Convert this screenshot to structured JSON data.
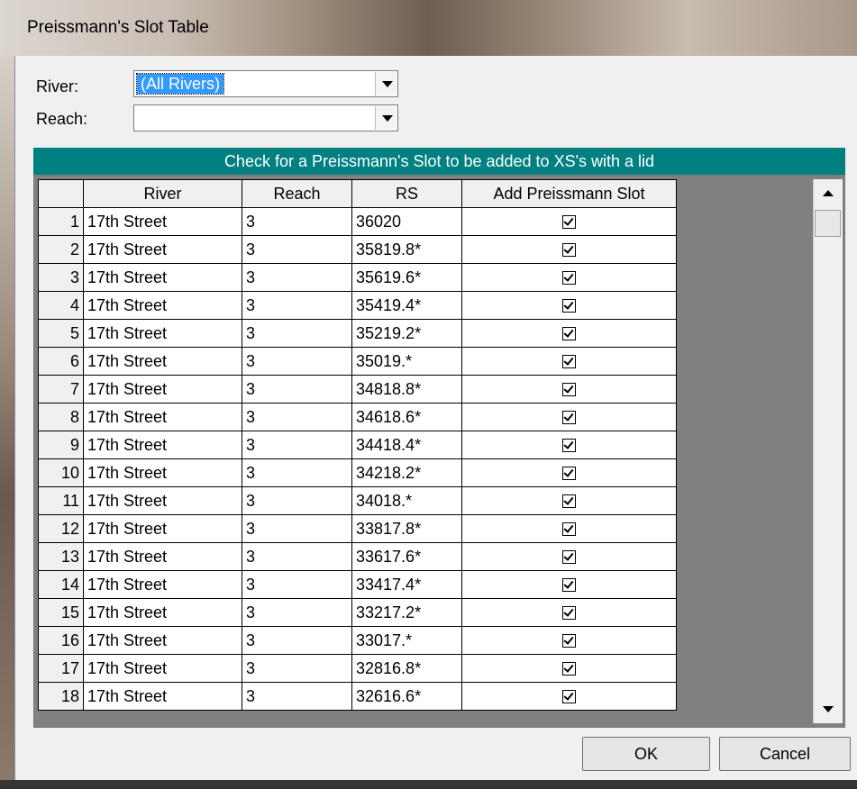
{
  "window": {
    "title": "Preissmann's Slot Table"
  },
  "river": {
    "label": "River:",
    "value": "(All Rivers)"
  },
  "reach": {
    "label": "Reach:",
    "value": ""
  },
  "banner": "Check for a Preissmann's Slot to be added to XS's with a lid",
  "table": {
    "headers": [
      "",
      "River",
      "Reach",
      "RS",
      "Add Preissmann Slot"
    ],
    "rows": [
      {
        "n": "1",
        "river": "17th Street",
        "reach": "3",
        "rs": "36020",
        "checked": true
      },
      {
        "n": "2",
        "river": "17th Street",
        "reach": "3",
        "rs": "35819.8*",
        "checked": true
      },
      {
        "n": "3",
        "river": "17th Street",
        "reach": "3",
        "rs": "35619.6*",
        "checked": true
      },
      {
        "n": "4",
        "river": "17th Street",
        "reach": "3",
        "rs": "35419.4*",
        "checked": true
      },
      {
        "n": "5",
        "river": "17th Street",
        "reach": "3",
        "rs": "35219.2*",
        "checked": true
      },
      {
        "n": "6",
        "river": "17th Street",
        "reach": "3",
        "rs": "35019.*",
        "checked": true
      },
      {
        "n": "7",
        "river": "17th Street",
        "reach": "3",
        "rs": "34818.8*",
        "checked": true
      },
      {
        "n": "8",
        "river": "17th Street",
        "reach": "3",
        "rs": "34618.6*",
        "checked": true
      },
      {
        "n": "9",
        "river": "17th Street",
        "reach": "3",
        "rs": "34418.4*",
        "checked": true
      },
      {
        "n": "10",
        "river": "17th Street",
        "reach": "3",
        "rs": "34218.2*",
        "checked": true
      },
      {
        "n": "11",
        "river": "17th Street",
        "reach": "3",
        "rs": "34018.*",
        "checked": true
      },
      {
        "n": "12",
        "river": "17th Street",
        "reach": "3",
        "rs": "33817.8*",
        "checked": true
      },
      {
        "n": "13",
        "river": "17th Street",
        "reach": "3",
        "rs": "33617.6*",
        "checked": true
      },
      {
        "n": "14",
        "river": "17th Street",
        "reach": "3",
        "rs": "33417.4*",
        "checked": true
      },
      {
        "n": "15",
        "river": "17th Street",
        "reach": "3",
        "rs": "33217.2*",
        "checked": true
      },
      {
        "n": "16",
        "river": "17th Street",
        "reach": "3",
        "rs": "33017.*",
        "checked": true
      },
      {
        "n": "17",
        "river": "17th Street",
        "reach": "3",
        "rs": "32816.8*",
        "checked": true
      },
      {
        "n": "18",
        "river": "17th Street",
        "reach": "3",
        "rs": "32616.6*",
        "checked": true
      }
    ]
  },
  "buttons": {
    "ok": "OK",
    "cancel": "Cancel"
  },
  "colors": {
    "banner": "#008080",
    "selection": "#3399ff",
    "grid_empty": "#808080"
  }
}
